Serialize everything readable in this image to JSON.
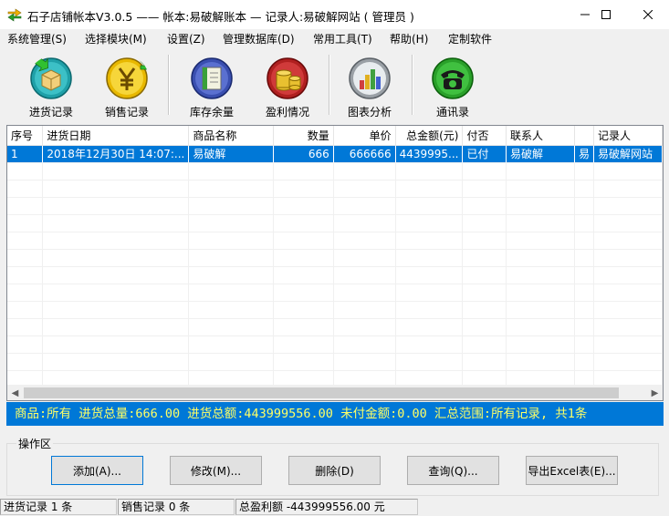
{
  "window": {
    "title": "石子店铺帐本V3.0.5  ——  帐本:易破解账本 — 记录人:易破解网站 ( 管理员 )",
    "minimize_icon": "minimize-icon",
    "maximize_icon": "maximize-icon",
    "close_icon": "close-icon"
  },
  "menu": [
    {
      "label": "系统管理(S)"
    },
    {
      "label": "选择模块(M)"
    },
    {
      "label": "设置(Z)"
    },
    {
      "label": "管理数据库(D)"
    },
    {
      "label": "常用工具(T)"
    },
    {
      "label": "帮助(H)"
    },
    {
      "label": "定制软件"
    }
  ],
  "toolbar": [
    {
      "label": "进货记录",
      "icon": "purchase-box-icon",
      "color": "#1fa0a8"
    },
    {
      "label": "销售记录",
      "icon": "yuan-coin-icon",
      "color": "#e8b800"
    },
    {
      "label": "库存余量",
      "icon": "inventory-book-icon",
      "color": "#3a4fb0"
    },
    {
      "label": "盈利情况",
      "icon": "coins-stack-icon",
      "color": "#b02020"
    },
    {
      "label": "图表分析",
      "icon": "bar-chart-icon",
      "color": "#9aa0a6"
    },
    {
      "label": "通讯录",
      "icon": "telephone-icon",
      "color": "#2aa02a"
    }
  ],
  "table": {
    "columns": [
      "序号",
      "进货日期",
      "商品名称",
      "数量",
      "单价",
      "总金额(元)",
      "付否",
      "联系人",
      "",
      "记录人"
    ],
    "rows": [
      [
        "1",
        "2018年12月30日 14:07:...",
        "易破解",
        "666",
        "666666",
        "4439995...",
        "已付",
        "易破解",
        "易",
        "易破解网站"
      ]
    ]
  },
  "summary": "商品:所有  进货总量:666.00  进货总额:443999556.00  未付金额:0.00  汇总范围:所有记录, 共1条",
  "operations": {
    "legend": "操作区",
    "buttons": [
      "添加(A)...",
      "修改(M)...",
      "删除(D)",
      "查询(Q)...",
      "导出Excel表(E)..."
    ]
  },
  "status": [
    "进货记录 1 条",
    "销售记录 0 条",
    "总盈利额 -443999556.00 元"
  ],
  "colors": {
    "selection": "#0078d7",
    "summary_text": "#ffff66"
  }
}
